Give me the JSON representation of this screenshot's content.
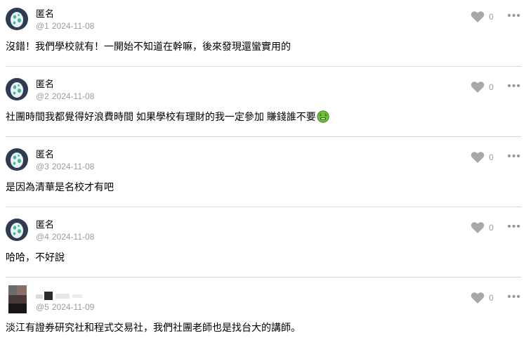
{
  "comments": [
    {
      "author": "匿名",
      "floor": "@1",
      "date": "2024-11-08",
      "likes": "0",
      "text": "沒錯！我們學校就有！一開始不知道在幹嘛，後來發現還蠻實用的",
      "avatar": "egg-icon"
    },
    {
      "author": "匿名",
      "floor": "@2",
      "date": "2024-11-08",
      "likes": "0",
      "text": "社團時間我都覺得好浪費時間 如果學校有理財的我一定參加 賺錢誰不要",
      "emoji": "money-mouth-face-icon",
      "avatar": "egg-icon"
    },
    {
      "author": "匿名",
      "floor": "@3",
      "date": "2024-11-08",
      "likes": "0",
      "text": "是因為清華是名校才有吧",
      "avatar": "egg-icon"
    },
    {
      "author": "匿名",
      "floor": "@4",
      "date": "2024-11-08",
      "likes": "0",
      "text": "哈哈，不好說",
      "avatar": "egg-icon"
    },
    {
      "author": "",
      "floor": "@5",
      "date": "2024-11-09",
      "likes": "0",
      "text": "淡江有證券研究社和程式交易社，我們社團老師也是找台大的講師。",
      "avatar": "blurred-profile-photo"
    }
  ],
  "icons": {
    "like": "heart-icon",
    "more": "more-options-icon"
  },
  "colors": {
    "avatar_bg": "#2f3b52",
    "egg": "#e9f2f1",
    "egg_spots": "#3fb9a0",
    "meta_text": "#9b9b9b",
    "heart": "#a8a8a8",
    "divider": "#d9d9d9"
  }
}
